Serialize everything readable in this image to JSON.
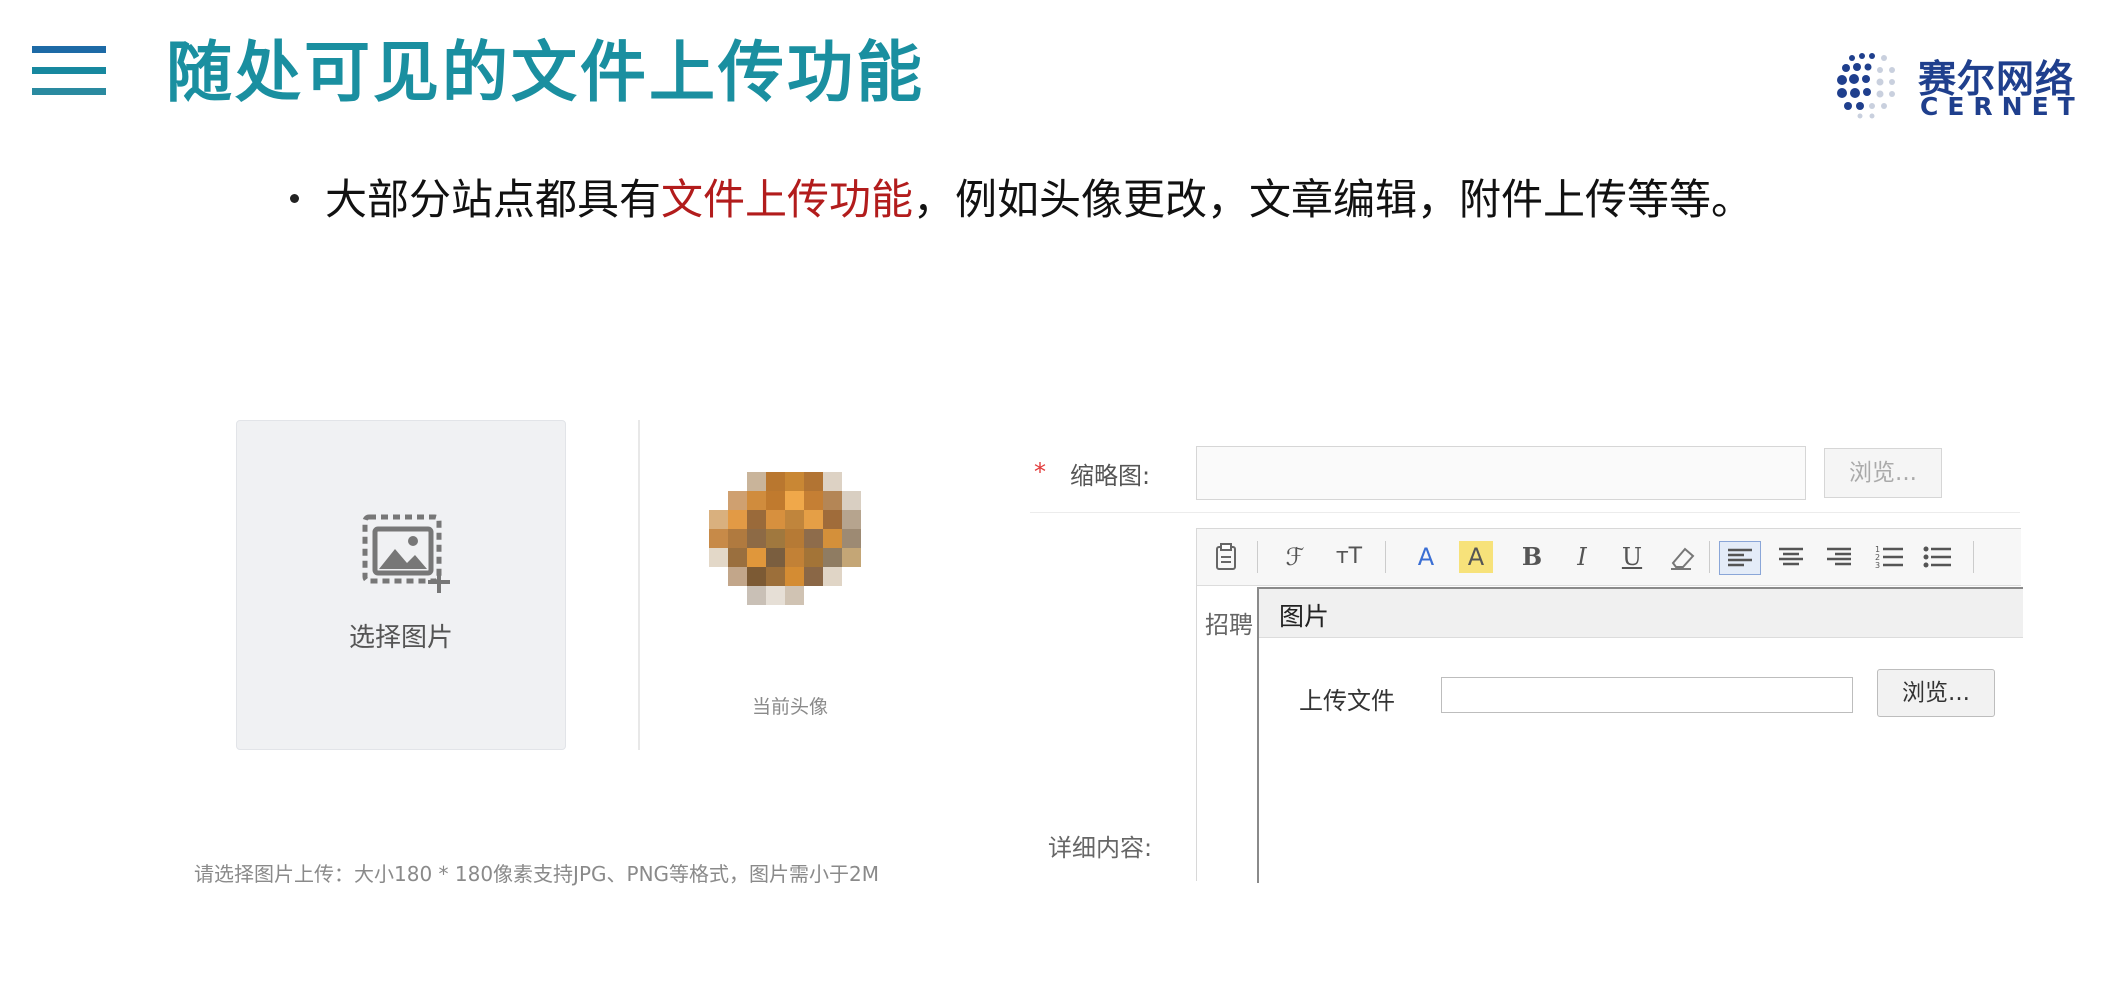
{
  "header": {
    "title": "随处可见的文件上传功能",
    "logo_cn": "赛尔网络",
    "logo_en": "CERNET",
    "menu_icon": "hamburger-icon"
  },
  "bullet": {
    "before": "大部分站点都具有",
    "highlight": "文件上传功能",
    "after": "，例如头像更改，文章编辑，附件上传等等。",
    "highlight_color": "#b21c1c"
  },
  "avatar_upload": {
    "select_label": "选择图片",
    "select_icon": "image-add-icon",
    "avatar_caption": "当前头像",
    "hint": "请选择图片上传：大小180 * 180像素支持JPG、PNG等格式，图片需小于2M"
  },
  "article_editor": {
    "required_mark": "*",
    "thumbnail_label": "缩略图:",
    "thumbnail_browse": "浏览...",
    "side_label": "招聘",
    "dialog_title": "图片",
    "upload_label": "上传文件",
    "upload_browse": "浏览...",
    "detail_label": "详细内容:",
    "toolbar": {
      "font_family": "ℱ",
      "font_size": "тT",
      "font_color": "A",
      "highlight": "A",
      "bold": "B",
      "italic": "I",
      "underline": "U"
    }
  },
  "colors": {
    "title": "#1a8fa0",
    "logo": "#1f3f8d",
    "required": "#e23a3a"
  }
}
